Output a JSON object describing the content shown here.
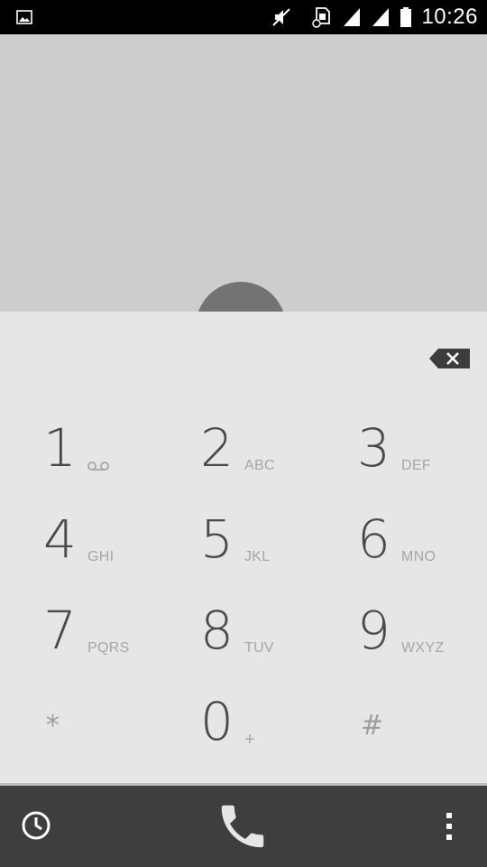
{
  "status_bar": {
    "time": "10:26",
    "left_icon": "image-icon",
    "right_icons": [
      "mute-icon",
      "sim-card-icon",
      "signal-icon",
      "signal-icon",
      "battery-icon"
    ]
  },
  "dialpad": {
    "keys": [
      {
        "digit": "1",
        "letters": "",
        "icon": "voicemail-icon"
      },
      {
        "digit": "2",
        "letters": "ABC"
      },
      {
        "digit": "3",
        "letters": "DEF"
      },
      {
        "digit": "4",
        "letters": "GHI"
      },
      {
        "digit": "5",
        "letters": "JKL"
      },
      {
        "digit": "6",
        "letters": "MNO"
      },
      {
        "digit": "7",
        "letters": "PQRS"
      },
      {
        "digit": "8",
        "letters": "TUV"
      },
      {
        "digit": "9",
        "letters": "WXYZ"
      },
      {
        "digit": "*",
        "letters": ""
      },
      {
        "digit": "0",
        "letters": "+"
      },
      {
        "digit": "#",
        "letters": ""
      }
    ]
  },
  "action_bar": {
    "left_icon": "history-icon",
    "center_icon": "phone-icon",
    "right_icon": "more-vert-icon"
  },
  "colors": {
    "upper_bg": "#cdcdcd",
    "dialpad_bg": "#e6e6e6",
    "action_bar_bg": "#3e3e3e",
    "digit": "#4a4a4a"
  }
}
